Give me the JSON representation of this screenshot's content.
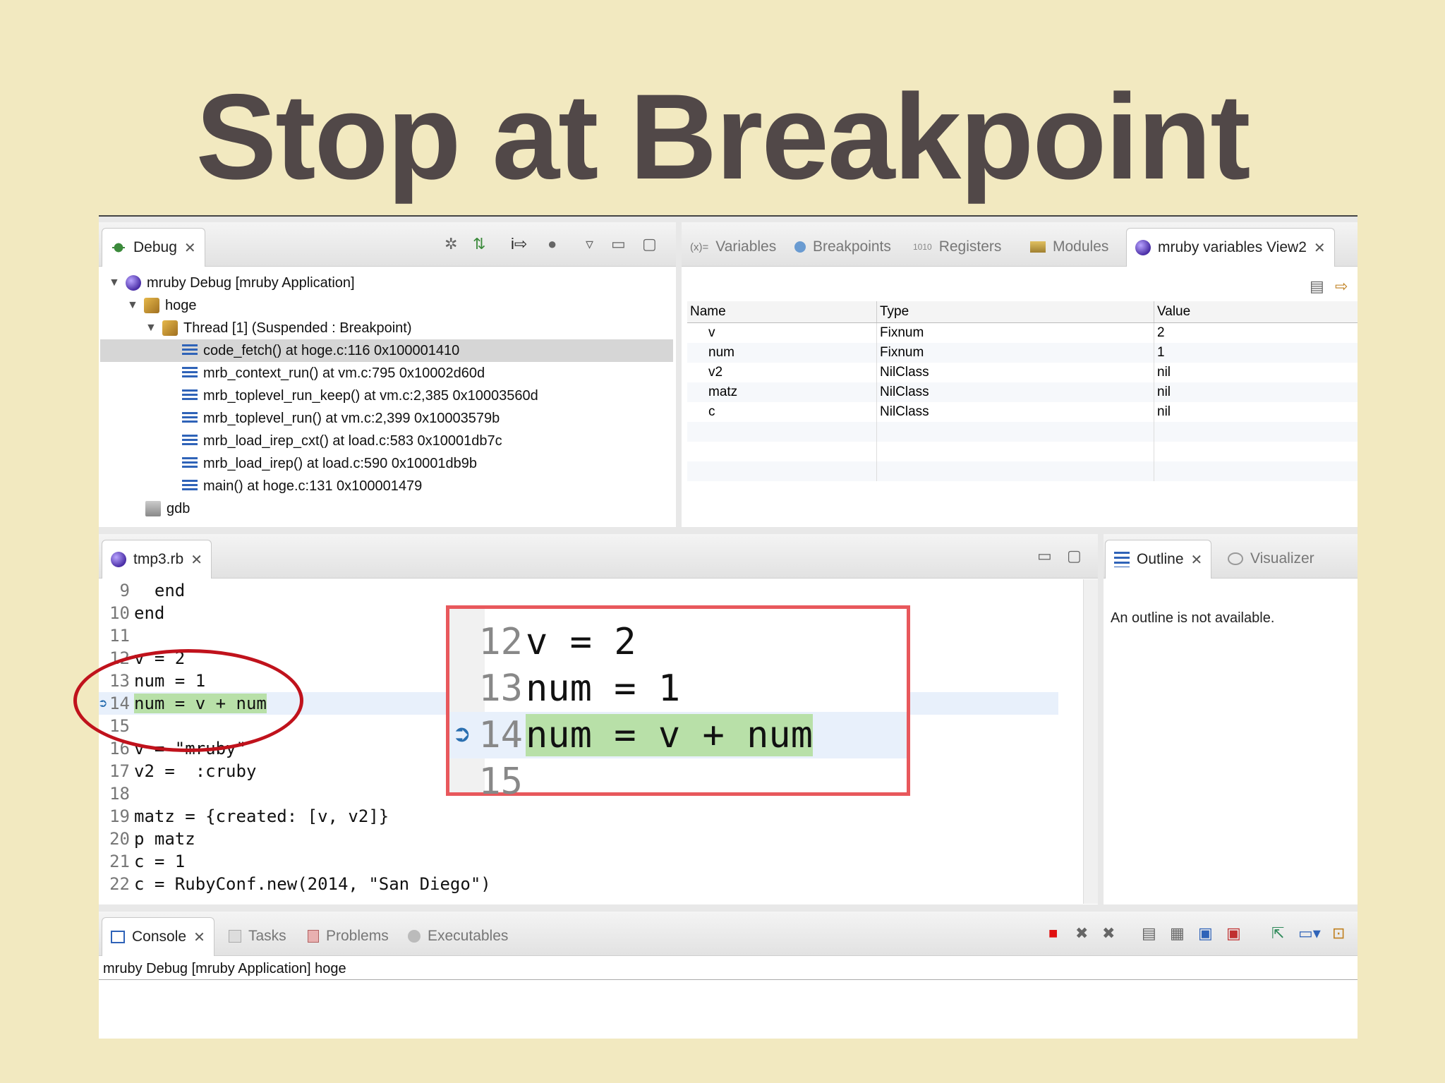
{
  "slide": {
    "title": "Stop at Breakpoint"
  },
  "debug_view": {
    "tab_label": "Debug",
    "tree": [
      {
        "label": "mruby Debug [mruby Application]",
        "icon": "ruby-icon"
      },
      {
        "label": "hoge",
        "icon": "process-icon"
      },
      {
        "label": "Thread [1] (Suspended : Breakpoint)",
        "icon": "thread-icon"
      },
      {
        "label": "code_fetch() at hoge.c:116 0x100001410",
        "icon": "stack-frame-icon"
      },
      {
        "label": "mrb_context_run() at vm.c:795 0x10002d60d",
        "icon": "stack-frame-icon"
      },
      {
        "label": "mrb_toplevel_run_keep() at vm.c:2,385 0x10003560d",
        "icon": "stack-frame-icon"
      },
      {
        "label": "mrb_toplevel_run() at vm.c:2,399 0x10003579b",
        "icon": "stack-frame-icon"
      },
      {
        "label": "mrb_load_irep_cxt() at load.c:583 0x10001db7c",
        "icon": "stack-frame-icon"
      },
      {
        "label": "mrb_load_irep() at load.c:590 0x10001db9b",
        "icon": "stack-frame-icon"
      },
      {
        "label": "main() at hoge.c:131 0x100001479",
        "icon": "stack-frame-icon"
      },
      {
        "label": "gdb",
        "icon": "gdb-icon"
      }
    ]
  },
  "variables_view": {
    "tabs": [
      "Variables",
      "Breakpoints",
      "Registers",
      "Modules",
      "mruby variables View2"
    ],
    "tab_prefix": "(x)=",
    "columns": [
      "Name",
      "Type",
      "Value"
    ],
    "rows": [
      [
        "v",
        "Fixnum",
        "2"
      ],
      [
        "num",
        "Fixnum",
        "1"
      ],
      [
        "v2",
        "NilClass",
        "nil"
      ],
      [
        "matz",
        "NilClass",
        "nil"
      ],
      [
        "c",
        "NilClass",
        "nil"
      ]
    ]
  },
  "editor": {
    "tab_label": "tmp3.rb",
    "lines": [
      {
        "n": "9",
        "text": "  end"
      },
      {
        "n": "10",
        "text": "end"
      },
      {
        "n": "11",
        "text": ""
      },
      {
        "n": "12",
        "text": "v = 2"
      },
      {
        "n": "13",
        "text": "num = 1"
      },
      {
        "n": "14",
        "text": "num = v + num"
      },
      {
        "n": "15",
        "text": ""
      },
      {
        "n": "16",
        "text": "v = \"mruby\""
      },
      {
        "n": "17",
        "text": "v2 =  :cruby"
      },
      {
        "n": "18",
        "text": ""
      },
      {
        "n": "19",
        "text": "matz = {created: [v, v2]}"
      },
      {
        "n": "20",
        "text": "p matz"
      },
      {
        "n": "21",
        "text": "c = 1"
      },
      {
        "n": "22",
        "text": "c = RubyConf.new(2014, \"San Diego\")"
      }
    ],
    "current_line": "14"
  },
  "zoom": {
    "lines": [
      {
        "n": "12",
        "text": "v = 2"
      },
      {
        "n": "13",
        "text": "num = 1"
      },
      {
        "n": "14",
        "text": "num = v + num"
      },
      {
        "n": "15",
        "text": ""
      }
    ]
  },
  "outline_view": {
    "tabs": [
      "Outline",
      "Visualizer"
    ],
    "message": "An outline is not available."
  },
  "console_view": {
    "tabs": [
      "Console",
      "Tasks",
      "Problems",
      "Executables"
    ],
    "status": "mruby Debug [mruby Application] hoge"
  },
  "colors": {
    "background": "#f2e9c0",
    "title": "#514848",
    "highlight": "#b8e0a8",
    "zoom_border": "#e8585c",
    "ellipse": "#c0121c"
  }
}
